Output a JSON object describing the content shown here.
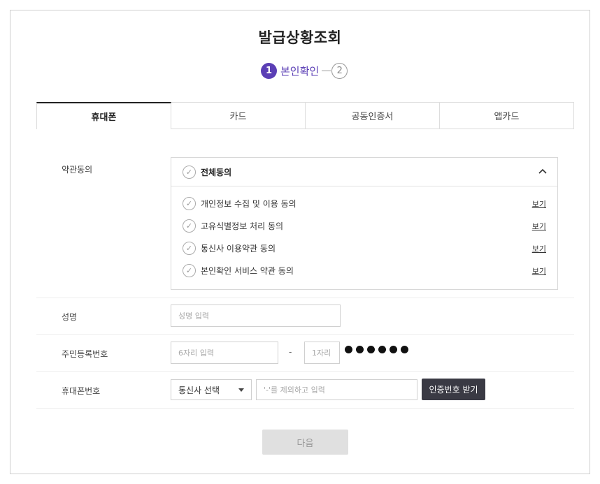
{
  "page": {
    "title": "발급상황조회"
  },
  "steps": {
    "step1_number": "1",
    "step1_label": "본인확인",
    "step2_number": "2"
  },
  "tabs": [
    {
      "label": "휴대폰",
      "active": true
    },
    {
      "label": "카드",
      "active": false
    },
    {
      "label": "공동인증서",
      "active": false
    },
    {
      "label": "앱카드",
      "active": false
    }
  ],
  "terms": {
    "row_label": "약관동의",
    "all_label": "전체동의",
    "items": [
      {
        "label": "개인정보 수집 및 이용 동의",
        "view": "보기"
      },
      {
        "label": "고유식별정보 처리 동의",
        "view": "보기"
      },
      {
        "label": "통신사 이용약관 동의",
        "view": "보기"
      },
      {
        "label": "본인확인 서비스 약관 동의",
        "view": "보기"
      }
    ]
  },
  "name": {
    "label": "성명",
    "placeholder": "성명 입력"
  },
  "resident": {
    "label": "주민등록번호",
    "front_placeholder": "6자리 입력",
    "separator": "-",
    "back_placeholder": "1자리",
    "masked_count": 6
  },
  "phone": {
    "label": "휴대폰번호",
    "carrier_select": "통신사 선택",
    "number_placeholder": "'-'를 제외하고 입력",
    "auth_button": "인증번호 받기"
  },
  "next_button": "다음",
  "colors": {
    "accent": "#5b3fb5",
    "dark_button": "#3a3a44",
    "disabled_button": "#e0e0e0"
  }
}
